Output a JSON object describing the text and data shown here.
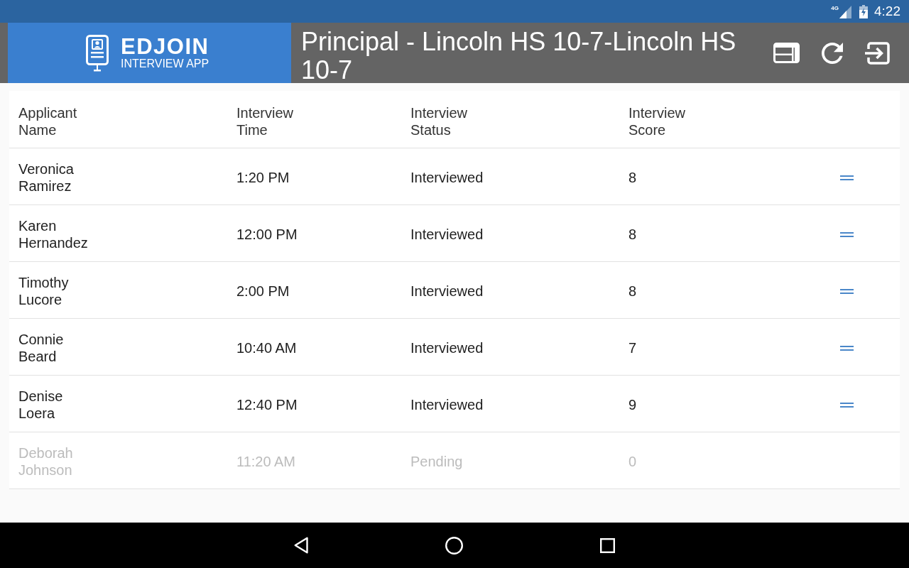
{
  "status_bar": {
    "network": "4G",
    "time": "4:22"
  },
  "app_bar": {
    "logo": {
      "name": "EDJOIN",
      "tagline": "INTERVIEW APP"
    },
    "title": "Principal - Lincoln HS 10-7-Lincoln HS 10-7"
  },
  "table": {
    "columns": [
      "Applicant Name",
      "Interview Time",
      "Interview Status",
      "Interview Score"
    ],
    "rows": [
      {
        "name": "Veronica Ramirez",
        "time": "1:20 PM",
        "status": "Interviewed",
        "score": "8",
        "disabled": false
      },
      {
        "name": "Karen Hernandez",
        "time": "12:00 PM",
        "status": "Interviewed",
        "score": "8",
        "disabled": false
      },
      {
        "name": "Timothy Lucore",
        "time": "2:00 PM",
        "status": "Interviewed",
        "score": "8",
        "disabled": false
      },
      {
        "name": "Connie Beard",
        "time": "10:40 AM",
        "status": "Interviewed",
        "score": "7",
        "disabled": false
      },
      {
        "name": "Denise Loera",
        "time": "12:40 PM",
        "status": "Interviewed",
        "score": "9",
        "disabled": false
      },
      {
        "name": "Deborah Johnson",
        "time": "11:20 AM",
        "status": "Pending",
        "score": "0",
        "disabled": true
      }
    ]
  }
}
